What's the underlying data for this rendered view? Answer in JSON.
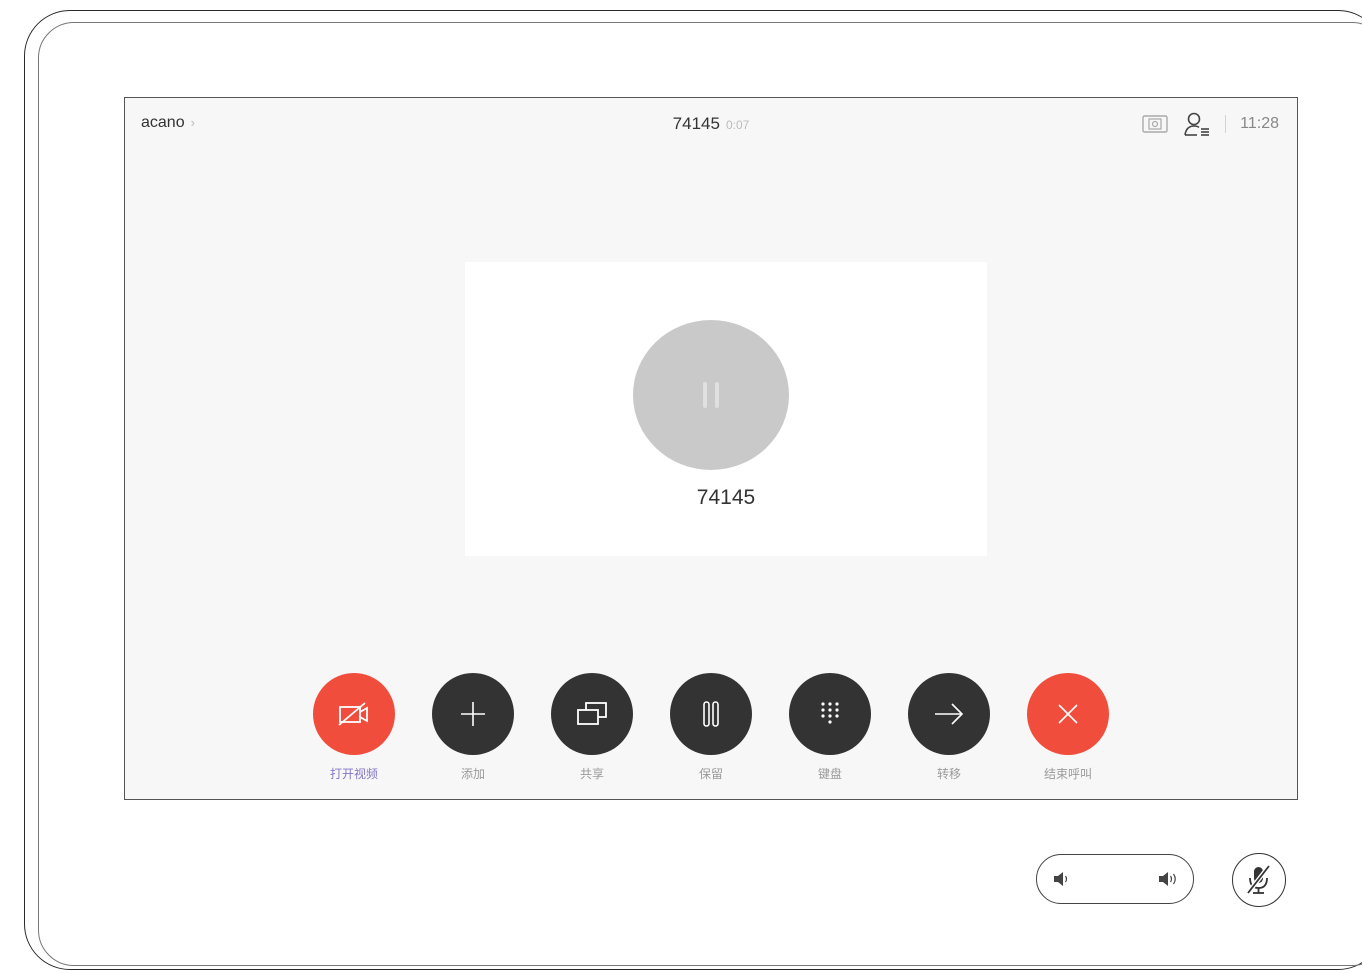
{
  "header": {
    "site_name": "acano",
    "site_chevron": "›",
    "call_number": "74145",
    "call_duration": "0:07",
    "clock": "11:28"
  },
  "stage": {
    "participant_number": "74145"
  },
  "controls": [
    {
      "label": "打开视频",
      "icon": "camera-off-icon",
      "color": "#f04d3c"
    },
    {
      "label": "添加",
      "icon": "plus-icon",
      "color": "#333333"
    },
    {
      "label": "共享",
      "icon": "share-screen-icon",
      "color": "#333333"
    },
    {
      "label": "保留",
      "icon": "hold-icon",
      "color": "#333333"
    },
    {
      "label": "键盘",
      "icon": "keypad-icon",
      "color": "#333333"
    },
    {
      "label": "转移",
      "icon": "transfer-arrow-icon",
      "color": "#333333"
    },
    {
      "label": "结束呼叫",
      "icon": "end-call-icon",
      "color": "#f04d3c"
    }
  ],
  "colors": {
    "accent_red": "#f04d3c",
    "control_dark": "#333333",
    "label_accent": "#8577c8"
  }
}
